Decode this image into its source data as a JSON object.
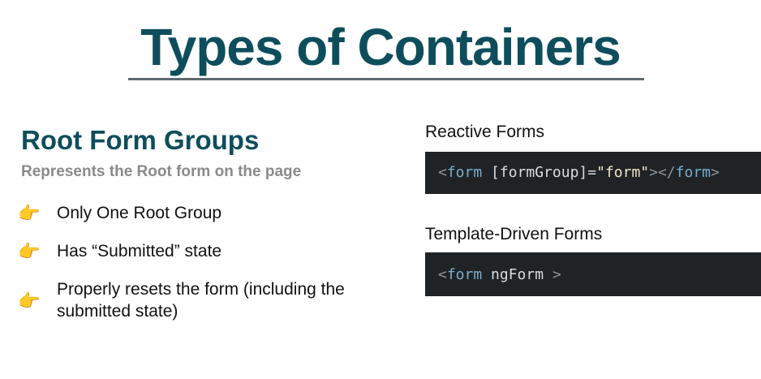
{
  "slide": {
    "title": "Types of Containers"
  },
  "section": {
    "heading": "Root Form Groups",
    "subtitle": "Represents the Root form on the page",
    "bullets": [
      {
        "icon": "pointing-hand-icon",
        "text": "Only One Root Group"
      },
      {
        "icon": "pointing-hand-icon",
        "text": "Has “Submitted” state"
      },
      {
        "icon": "pointing-hand-icon",
        "text": "Properly resets the form (including the submitted state)"
      }
    ]
  },
  "examples": {
    "reactive": {
      "label": "Reactive Forms",
      "code": {
        "open_lt": "<",
        "tag": "form",
        "attr": " [formGroup]=",
        "value": "\"form\"",
        "gt_lt_slash": "></",
        "close_tag": "form",
        "close_gt": ">"
      }
    },
    "template": {
      "label": "Template-Driven Forms",
      "code": {
        "open_lt": "<",
        "tag": "form",
        "attr": " ngForm ",
        "close_gt": ">"
      }
    }
  },
  "colors": {
    "title": "#0e4e5c",
    "subtitle": "#8a8a8a",
    "code_background": "#1f2326",
    "hand_icon": "#f2b01e"
  }
}
